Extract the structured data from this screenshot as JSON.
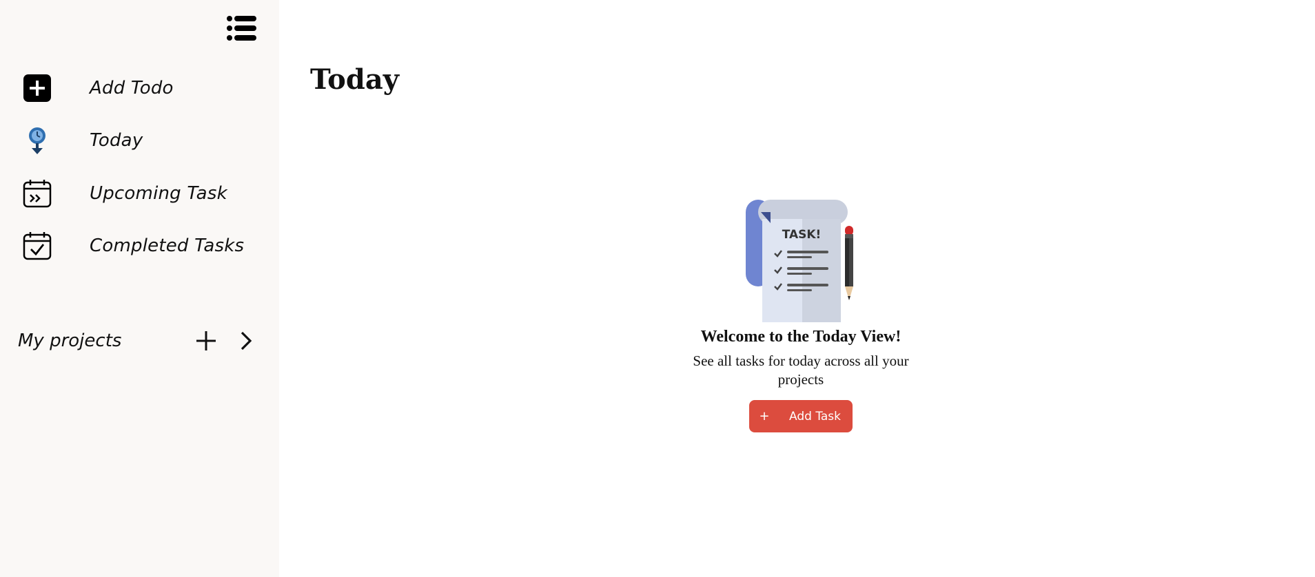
{
  "sidebar": {
    "toggle_icon": "list-icon",
    "items": [
      {
        "label": "Add Todo",
        "icon": "plus-square-icon"
      },
      {
        "label": "Today",
        "icon": "clock-pin-icon"
      },
      {
        "label": "Upcoming Task",
        "icon": "calendar-forward-icon"
      },
      {
        "label": "Completed Tasks",
        "icon": "calendar-check-icon"
      }
    ],
    "projects": {
      "label": "My projects",
      "add_icon": "plus-icon",
      "expand_icon": "chevron-right-icon"
    }
  },
  "main": {
    "title": "Today",
    "empty_state": {
      "illustration_text": "TASK!",
      "heading": "Welcome to the Today View!",
      "description": "See all tasks for today across all your projects",
      "button_icon": "+",
      "button_label": "Add Task"
    }
  },
  "colors": {
    "sidebar_bg": "#faf8f6",
    "accent": "#dc4c3e",
    "today_icon": "#2f6fb0"
  }
}
